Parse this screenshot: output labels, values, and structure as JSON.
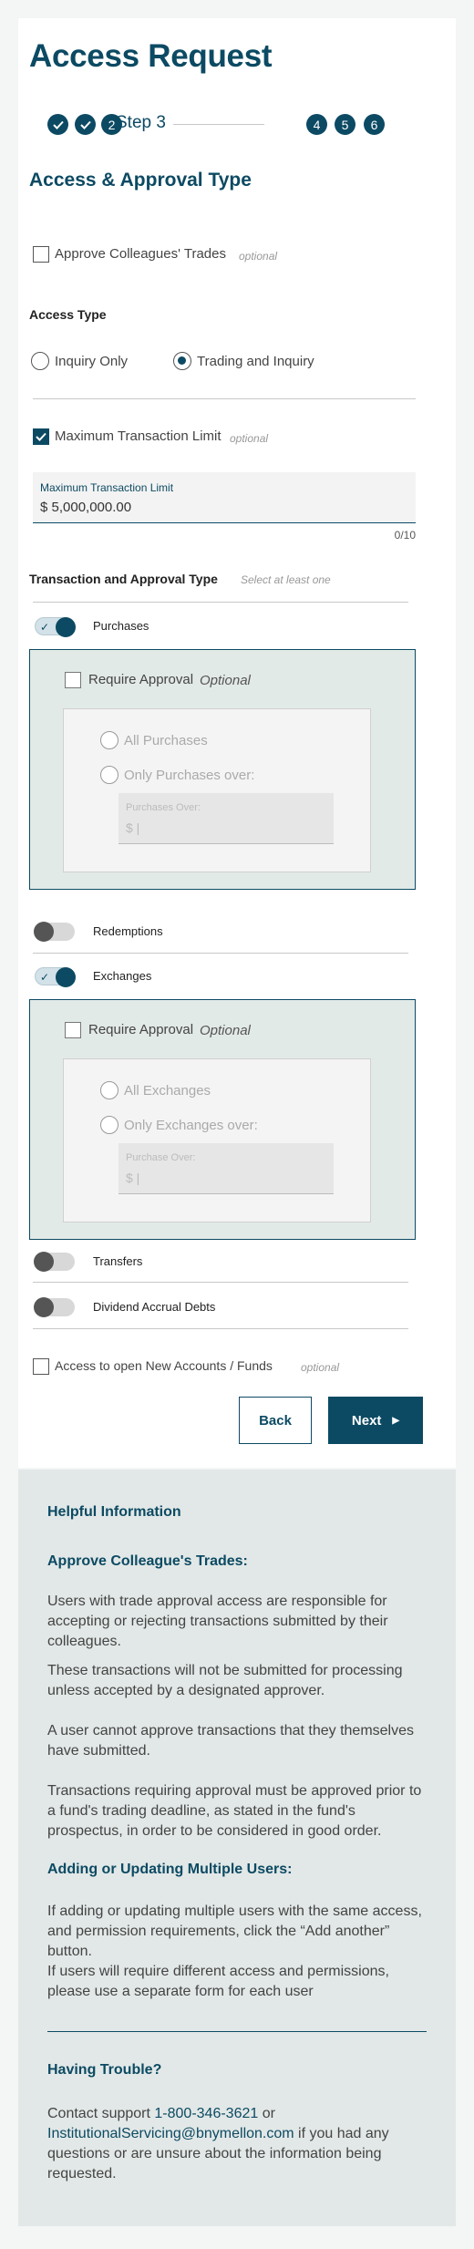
{
  "title": "Access Request",
  "stepper": {
    "current_number": "2",
    "current_label": "Step 3",
    "upcoming": [
      "4",
      "5",
      "6"
    ]
  },
  "section_title": "Access & Approval Type",
  "approve_colleagues": {
    "label": "Approve Colleagues' Trades",
    "optional": "optional",
    "checked": false
  },
  "access_type": {
    "heading": "Access Type",
    "options": [
      "Inquiry Only",
      "Trading and Inquiry"
    ],
    "selected": "Trading and Inquiry"
  },
  "max_limit": {
    "checkbox_label": "Maximum Transaction Limit",
    "optional": "optional",
    "checked": true,
    "field_label": "Maximum Transaction Limit",
    "field_value": "$ 5,000,000.00",
    "counter": "0/10"
  },
  "txn_section": {
    "heading": "Transaction and Approval Type",
    "hint": "Select at least one"
  },
  "purchases": {
    "label": "Purchases",
    "on": true,
    "require_label": "Require Approval",
    "require_optional": "Optional",
    "option_all": "All Purchases",
    "option_over": "Only Purchases over:",
    "over_field_label": "Purchases Over:",
    "over_field_value": "$ |"
  },
  "redemptions": {
    "label": "Redemptions",
    "on": false
  },
  "exchanges": {
    "label": "Exchanges",
    "on": true,
    "require_label": "Require Approval",
    "require_optional": "Optional",
    "option_all": "All Exchanges",
    "option_over": "Only Exchanges over:",
    "over_field_label": "Purchase Over:",
    "over_field_value": "$ |"
  },
  "transfers": {
    "label": "Transfers",
    "on": false
  },
  "dividend": {
    "label": "Dividend Accrual Debts",
    "on": false
  },
  "new_accounts": {
    "label": "Access to open New Accounts / Funds",
    "optional": "optional",
    "checked": false
  },
  "buttons": {
    "back": "Back",
    "next": "Next"
  },
  "info": {
    "heading": "Helpful Information",
    "approve_heading": "Approve Colleague's Trades:",
    "p1": "Users with trade approval access are responsible for accepting or rejecting transactions submitted by their colleagues.",
    "p2": "These transactions will not be submitted for processing unless accepted by a designated approver.",
    "p3": "A user cannot approve transactions that they themselves have submitted.",
    "p4": "Transactions requiring approval must be approved prior to a fund's trading deadline, as stated in the fund's prospectus, in order to be considered in good order.",
    "multi_heading": "Adding or Updating Multiple Users:",
    "p5": "If adding or updating multiple users with the same access, and permission requirements, click the “Add another” button.",
    "p6": "If users will require different access and permissions, please use a separate form for each user",
    "trouble_heading": "Having Trouble?",
    "contact_prefix": "Contact support",
    "phone": "1-800-346-3621",
    "or": "or",
    "email": "InstitutionalServicing@bnymellon.com",
    "contact_suffix": "if you had any questions or are unsure about the information being requested."
  },
  "colors": {
    "primary": "#0c4a63",
    "panel_bg": "#e2eae7",
    "info_bg": "#e2e8e7"
  }
}
